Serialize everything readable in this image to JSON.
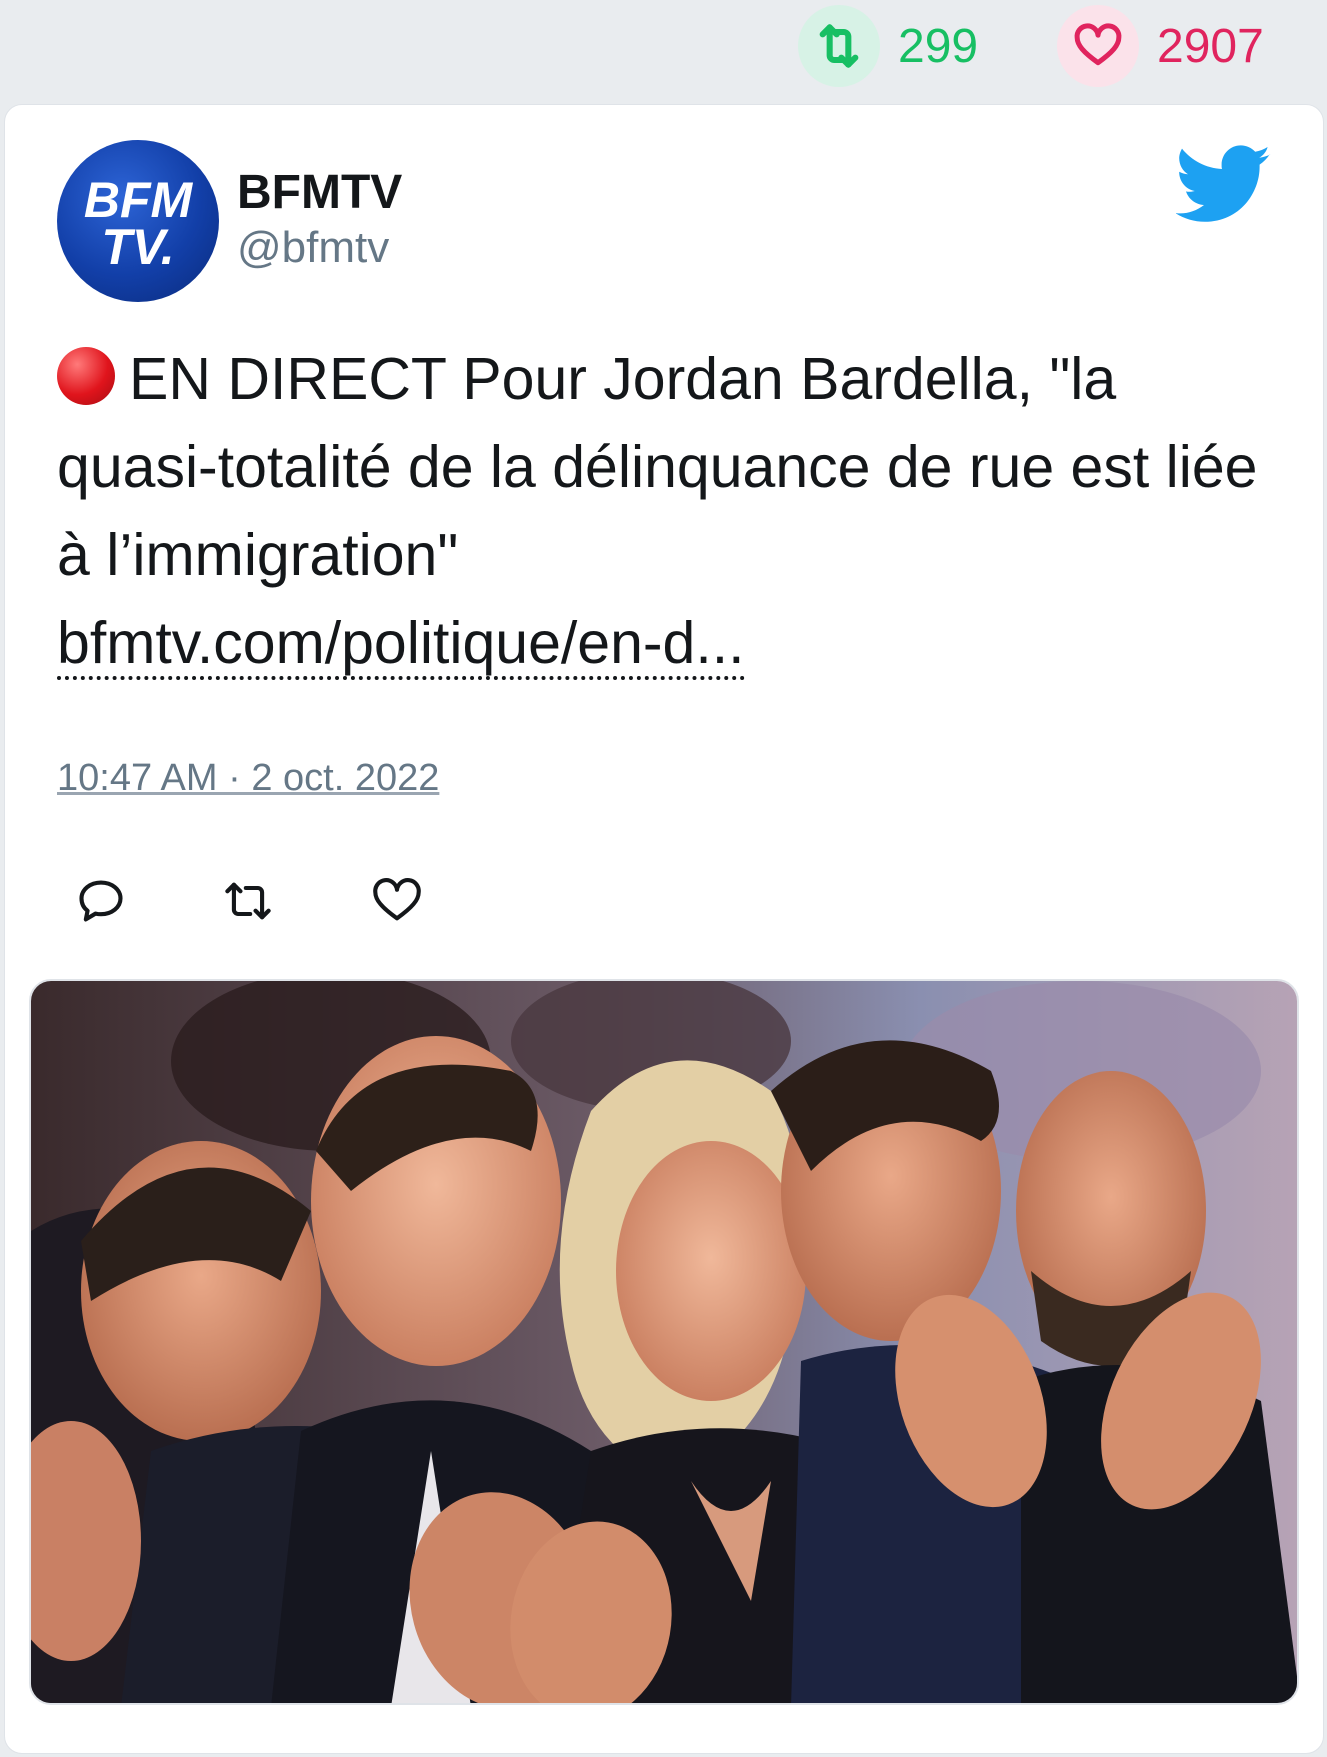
{
  "stats": {
    "retweets": "299",
    "likes": "2907",
    "retweet_icon": "retweet-icon",
    "like_icon": "heart-icon"
  },
  "author": {
    "name": "BFMTV",
    "handle": "@bfmtv",
    "avatar_text_top": "BFM",
    "avatar_text_bottom": "TV."
  },
  "tweet": {
    "text": "EN DIRECT Pour Jordan Bardella, \"la quasi-totalité de la délinquance de rue est liée à l’immigration\"",
    "link": "bfmtv.com/politique/en-d...",
    "timestamp": "10:47 AM · 2 oct. 2022"
  },
  "icons": {
    "brand": "twitter-bird-icon",
    "live": "red-circle-icon",
    "reply": "reply-icon",
    "retweet": "retweet-icon",
    "like": "heart-icon"
  },
  "colors": {
    "twitter_blue": "#1da1f2",
    "retweet_green": "#17bf63",
    "like_red": "#e0245e",
    "text": "#14171a",
    "muted": "#657786"
  }
}
